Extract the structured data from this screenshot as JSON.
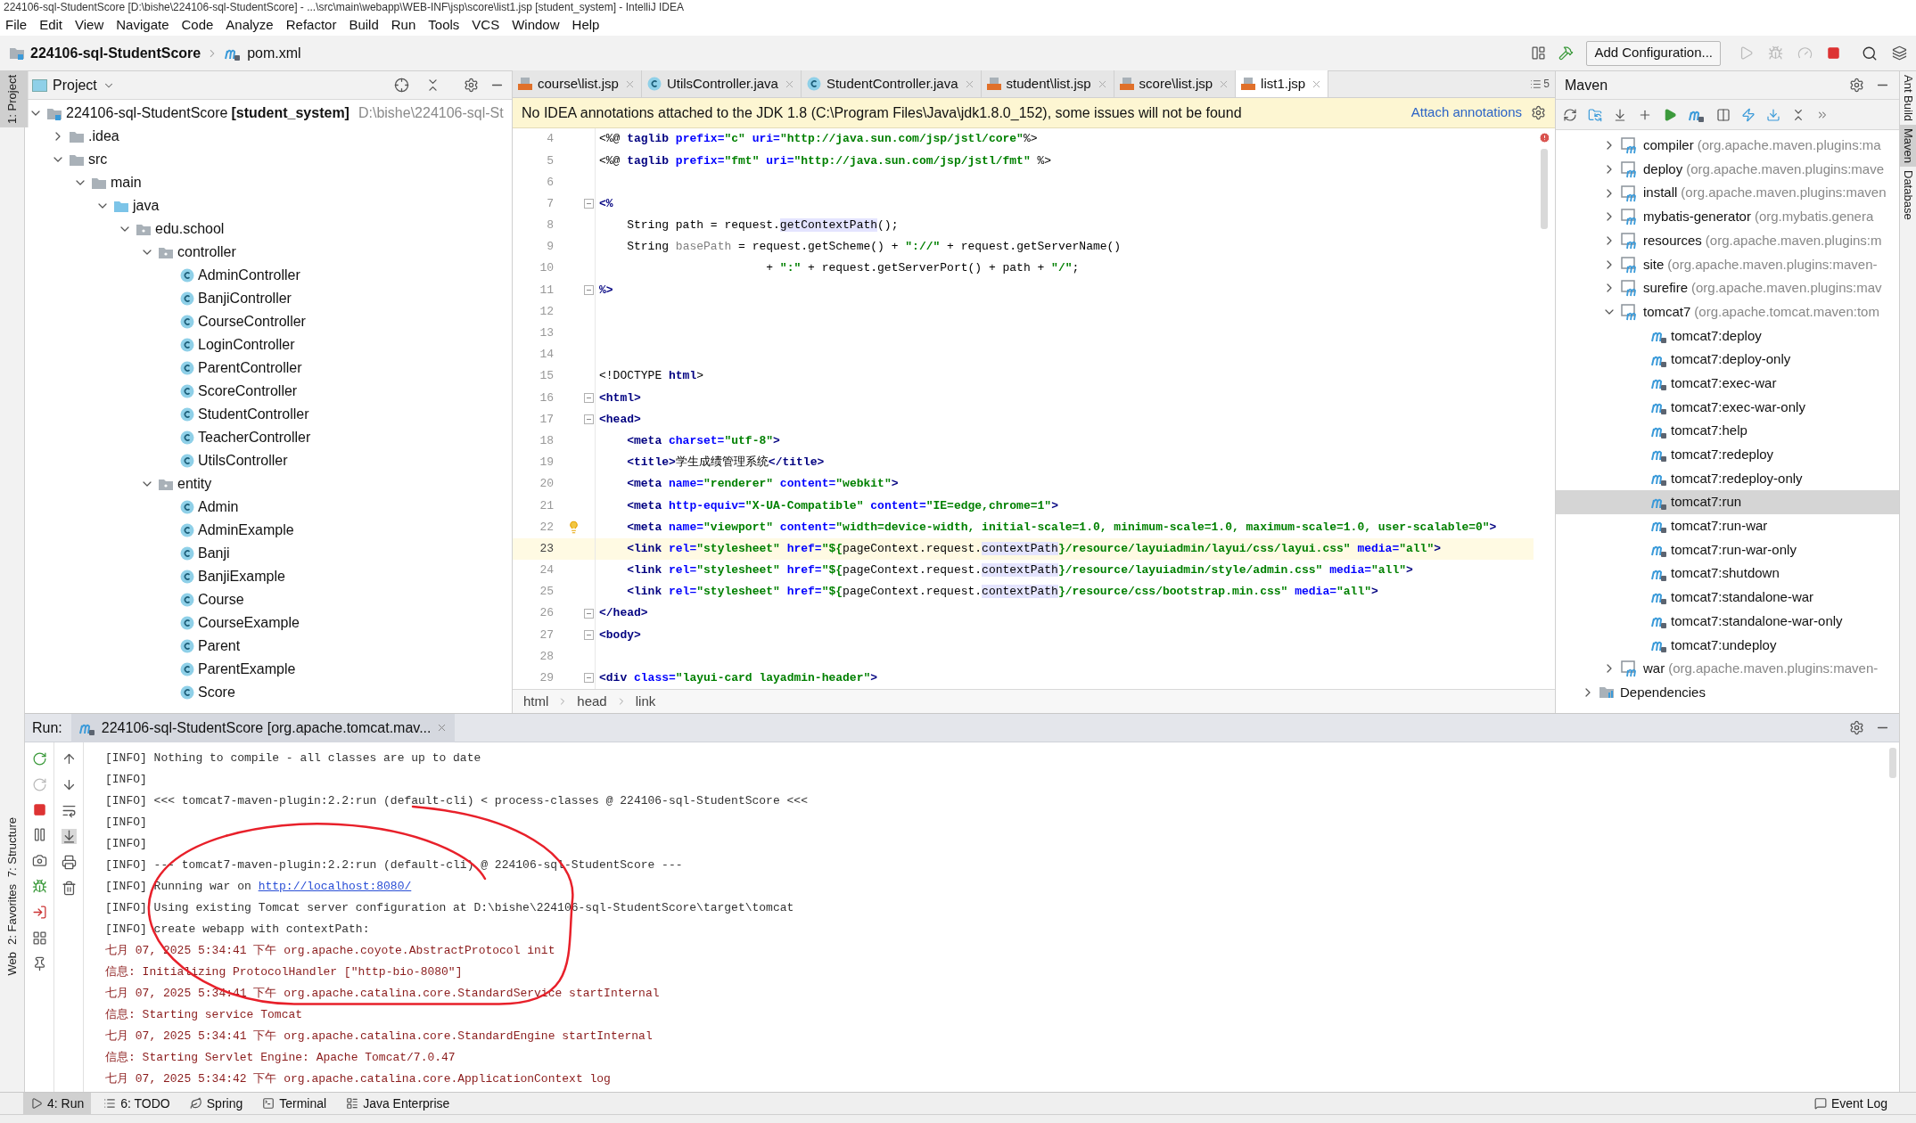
{
  "window": {
    "title": "224106-sql-StudentScore [D:\\bishe\\224106-sql-StudentScore] - ...\\src\\main\\webapp\\WEB-INF\\jsp\\score\\list1.jsp [student_system] - IntelliJ IDEA"
  },
  "menu": [
    "File",
    "Edit",
    "View",
    "Navigate",
    "Code",
    "Analyze",
    "Refactor",
    "Build",
    "Run",
    "Tools",
    "VCS",
    "Window",
    "Help"
  ],
  "navbar": {
    "project": "224106-sql-StudentScore",
    "file": "pom.xml",
    "run_config": "Add Configuration..."
  },
  "side_tabs_left": [
    {
      "label": "1: Project",
      "selected": true,
      "kind": "top"
    },
    {
      "label": "7: Structure",
      "selected": false,
      "kind": "bottom"
    },
    {
      "label": "2: Favorites",
      "selected": false,
      "kind": "bottom"
    },
    {
      "label": "Web",
      "selected": false,
      "kind": "bottom"
    }
  ],
  "side_tabs_right": [
    {
      "label": "Ant Build",
      "selected": false
    },
    {
      "label": "Maven",
      "selected": true
    },
    {
      "label": "Database",
      "selected": false
    }
  ],
  "project": {
    "title": "Project",
    "tree": [
      {
        "label": "224106-sql-StudentScore",
        "module": "[student_system]",
        "path": "D:\\bishe\\224106-sql-St",
        "kind": "module",
        "expanded": true,
        "children": [
          {
            "label": ".idea",
            "kind": "folder",
            "expanded": false
          },
          {
            "label": "src",
            "kind": "folder",
            "expanded": true,
            "children": [
              {
                "label": "main",
                "kind": "folder",
                "expanded": true,
                "children": [
                  {
                    "label": "java",
                    "kind": "source",
                    "expanded": true,
                    "children": [
                      {
                        "label": "edu.school",
                        "kind": "package",
                        "expanded": true,
                        "children": [
                          {
                            "label": "controller",
                            "kind": "package",
                            "expanded": true,
                            "children": [
                              {
                                "label": "AdminController",
                                "kind": "class"
                              },
                              {
                                "label": "BanjiController",
                                "kind": "class"
                              },
                              {
                                "label": "CourseController",
                                "kind": "class"
                              },
                              {
                                "label": "LoginController",
                                "kind": "class"
                              },
                              {
                                "label": "ParentController",
                                "kind": "class"
                              },
                              {
                                "label": "ScoreController",
                                "kind": "class"
                              },
                              {
                                "label": "StudentController",
                                "kind": "class"
                              },
                              {
                                "label": "TeacherController",
                                "kind": "class"
                              },
                              {
                                "label": "UtilsController",
                                "kind": "class"
                              }
                            ]
                          },
                          {
                            "label": "entity",
                            "kind": "package",
                            "expanded": true,
                            "children": [
                              {
                                "label": "Admin",
                                "kind": "class"
                              },
                              {
                                "label": "AdminExample",
                                "kind": "class"
                              },
                              {
                                "label": "Banji",
                                "kind": "class"
                              },
                              {
                                "label": "BanjiExample",
                                "kind": "class"
                              },
                              {
                                "label": "Course",
                                "kind": "class"
                              },
                              {
                                "label": "CourseExample",
                                "kind": "class"
                              },
                              {
                                "label": "Parent",
                                "kind": "class"
                              },
                              {
                                "label": "ParentExample",
                                "kind": "class"
                              },
                              {
                                "label": "Score",
                                "kind": "class"
                              }
                            ]
                          }
                        ]
                      }
                    ]
                  }
                ]
              }
            ]
          }
        ]
      }
    ]
  },
  "editor": {
    "tabs": [
      {
        "label": "course\\list.jsp",
        "kind": "jsp",
        "selected": false
      },
      {
        "label": "UtilsController.java",
        "kind": "class",
        "selected": false
      },
      {
        "label": "StudentController.java",
        "kind": "class",
        "selected": false
      },
      {
        "label": "student\\list.jsp",
        "kind": "jsp",
        "selected": false
      },
      {
        "label": "score\\list.jsp",
        "kind": "jsp",
        "selected": false
      },
      {
        "label": "list1.jsp",
        "kind": "jsp",
        "selected": true
      }
    ],
    "tab_count": "5",
    "banner": {
      "text": "No IDEA annotations attached to the JDK 1.8 (C:\\Program Files\\Java\\jdk1.8.0_152), some issues will not be found",
      "action": "Attach annotations"
    },
    "lines": [
      {
        "number": "4",
        "fold": false,
        "current": false,
        "bulb": false,
        "segments": [
          {
            "text": "<%@ ",
            "kind": "plain"
          },
          {
            "text": "taglib ",
            "kind": "tag"
          },
          {
            "text": "prefix=",
            "kind": "attr"
          },
          {
            "text": "\"c\" ",
            "kind": "string"
          },
          {
            "text": "uri=",
            "kind": "attr"
          },
          {
            "text": "\"http://java.sun.com/jsp/jstl/core\"",
            "kind": "string"
          },
          {
            "text": "%>",
            "kind": "plain"
          }
        ]
      },
      {
        "number": "5",
        "fold": false,
        "current": false,
        "bulb": false,
        "segments": [
          {
            "text": "<%@ ",
            "kind": "plain"
          },
          {
            "text": "taglib ",
            "kind": "tag"
          },
          {
            "text": "prefix=",
            "kind": "attr"
          },
          {
            "text": "\"fmt\" ",
            "kind": "string"
          },
          {
            "text": "uri=",
            "kind": "attr"
          },
          {
            "text": "\"http://java.sun.com/jsp/jstl/fmt\" ",
            "kind": "string"
          },
          {
            "text": "%>",
            "kind": "plain"
          }
        ]
      },
      {
        "number": "6",
        "fold": false,
        "current": false,
        "bulb": false
      },
      {
        "number": "7",
        "fold": true,
        "current": false,
        "bulb": false,
        "segments": [
          {
            "text": "<%",
            "kind": "tag"
          }
        ]
      },
      {
        "number": "8",
        "fold": false,
        "current": false,
        "bulb": false,
        "segments": [
          {
            "text": "    String path = request.",
            "kind": "plain"
          },
          {
            "text": "getContextPath",
            "kind": "highlight"
          },
          {
            "text": "();",
            "kind": "plain"
          }
        ]
      },
      {
        "number": "9",
        "fold": false,
        "current": false,
        "bulb": false,
        "segments": [
          {
            "text": "    String ",
            "kind": "plain"
          },
          {
            "text": "basePath",
            "kind": "unused"
          },
          {
            "text": " = request.getScheme() + ",
            "kind": "plain"
          },
          {
            "text": "\"://\"",
            "kind": "string"
          },
          {
            "text": " + request.getServerName()",
            "kind": "plain"
          }
        ]
      },
      {
        "number": "10",
        "fold": false,
        "current": false,
        "bulb": false,
        "segments": [
          {
            "text": "                        + ",
            "kind": "plain"
          },
          {
            "text": "\":\"",
            "kind": "string"
          },
          {
            "text": " + request.getServerPort() + path + ",
            "kind": "plain"
          },
          {
            "text": "\"/\"",
            "kind": "string"
          },
          {
            "text": ";",
            "kind": "plain"
          }
        ]
      },
      {
        "number": "11",
        "fold": true,
        "current": false,
        "bulb": false,
        "segments": [
          {
            "text": "%>",
            "kind": "tag"
          }
        ]
      },
      {
        "number": "12",
        "fold": false,
        "current": false,
        "bulb": false
      },
      {
        "number": "13",
        "fold": false,
        "current": false,
        "bulb": false
      },
      {
        "number": "14",
        "fold": false,
        "current": false,
        "bulb": false
      },
      {
        "number": "15",
        "fold": false,
        "current": false,
        "bulb": false,
        "segments": [
          {
            "text": "<!DOCTYPE ",
            "kind": "plain"
          },
          {
            "text": "html",
            "kind": "tag"
          },
          {
            "text": ">",
            "kind": "plain"
          }
        ]
      },
      {
        "number": "16",
        "fold": true,
        "current": false,
        "bulb": false,
        "segments": [
          {
            "text": "<html>",
            "kind": "tag"
          }
        ]
      },
      {
        "number": "17",
        "fold": true,
        "current": false,
        "bulb": false,
        "segments": [
          {
            "text": "<head>",
            "kind": "tag"
          }
        ]
      },
      {
        "number": "18",
        "fold": false,
        "current": false,
        "bulb": false,
        "segments": [
          {
            "text": "    <meta ",
            "kind": "tag"
          },
          {
            "text": "charset=",
            "kind": "attr"
          },
          {
            "text": "\"utf-8\"",
            "kind": "string"
          },
          {
            "text": ">",
            "kind": "tag"
          }
        ]
      },
      {
        "number": "19",
        "fold": false,
        "current": false,
        "bulb": false,
        "segments": [
          {
            "text": "    <title>",
            "kind": "tag"
          },
          {
            "text": "学生成绩管理系统",
            "kind": "plain"
          },
          {
            "text": "</title>",
            "kind": "tag"
          }
        ]
      },
      {
        "number": "20",
        "fold": false,
        "current": false,
        "bulb": false,
        "segments": [
          {
            "text": "    <meta ",
            "kind": "tag"
          },
          {
            "text": "name=",
            "kind": "attr"
          },
          {
            "text": "\"renderer\" ",
            "kind": "string"
          },
          {
            "text": "content=",
            "kind": "attr"
          },
          {
            "text": "\"webkit\"",
            "kind": "string"
          },
          {
            "text": ">",
            "kind": "tag"
          }
        ]
      },
      {
        "number": "21",
        "fold": false,
        "current": false,
        "bulb": false,
        "segments": [
          {
            "text": "    <meta ",
            "kind": "tag"
          },
          {
            "text": "http-equiv=",
            "kind": "attr"
          },
          {
            "text": "\"X-UA-Compatible\" ",
            "kind": "string"
          },
          {
            "text": "content=",
            "kind": "attr"
          },
          {
            "text": "\"IE=edge,chrome=1\"",
            "kind": "string"
          },
          {
            "text": ">",
            "kind": "tag"
          }
        ]
      },
      {
        "number": "22",
        "fold": false,
        "current": false,
        "bulb": true,
        "segments": [
          {
            "text": "    <meta ",
            "kind": "tag"
          },
          {
            "text": "name=",
            "kind": "attr"
          },
          {
            "text": "\"viewport\" ",
            "kind": "string"
          },
          {
            "text": "content=",
            "kind": "attr"
          },
          {
            "text": "\"width=device-width, initial-scale=1.0, minimum-scale=1.0, maximum-scale=1.0, user-scalable=0\"",
            "kind": "string"
          },
          {
            "text": ">",
            "kind": "tag"
          }
        ]
      },
      {
        "number": "23",
        "fold": false,
        "current": true,
        "bulb": false,
        "segments": [
          {
            "text": "    <link ",
            "kind": "tag"
          },
          {
            "text": "rel=",
            "kind": "attr"
          },
          {
            "text": "\"stylesheet\" ",
            "kind": "string"
          },
          {
            "text": "href=",
            "kind": "attr"
          },
          {
            "text": "\"${",
            "kind": "string"
          },
          {
            "text": "pageContext.request.",
            "kind": "plain"
          },
          {
            "text": "contextPath",
            "kind": "highlight"
          },
          {
            "text": "}/resource/layuiadmin/layui/css/layui.css\" ",
            "kind": "string"
          },
          {
            "text": "media=",
            "kind": "attr"
          },
          {
            "text": "\"all\"",
            "kind": "string"
          },
          {
            "text": ">",
            "kind": "tag"
          }
        ]
      },
      {
        "number": "24",
        "fold": false,
        "current": false,
        "bulb": false,
        "segments": [
          {
            "text": "    <link ",
            "kind": "tag"
          },
          {
            "text": "rel=",
            "kind": "attr"
          },
          {
            "text": "\"stylesheet\" ",
            "kind": "string"
          },
          {
            "text": "href=",
            "kind": "attr"
          },
          {
            "text": "\"${",
            "kind": "string"
          },
          {
            "text": "pageContext.request.",
            "kind": "plain"
          },
          {
            "text": "contextPath",
            "kind": "highlight"
          },
          {
            "text": "}/resource/layuiadmin/style/admin.css\" ",
            "kind": "string"
          },
          {
            "text": "media=",
            "kind": "attr"
          },
          {
            "text": "\"all\"",
            "kind": "string"
          },
          {
            "text": ">",
            "kind": "tag"
          }
        ]
      },
      {
        "number": "25",
        "fold": false,
        "current": false,
        "bulb": false,
        "segments": [
          {
            "text": "    <link ",
            "kind": "tag"
          },
          {
            "text": "rel=",
            "kind": "attr"
          },
          {
            "text": "\"stylesheet\" ",
            "kind": "string"
          },
          {
            "text": "href=",
            "kind": "attr"
          },
          {
            "text": "\"${",
            "kind": "string"
          },
          {
            "text": "pageContext.request.",
            "kind": "plain"
          },
          {
            "text": "contextPath",
            "kind": "highlight"
          },
          {
            "text": "}/resource/css/bootstrap.min.css\" ",
            "kind": "string"
          },
          {
            "text": "media=",
            "kind": "attr"
          },
          {
            "text": "\"all\"",
            "kind": "string"
          },
          {
            "text": ">",
            "kind": "tag"
          }
        ]
      },
      {
        "number": "26",
        "fold": true,
        "current": false,
        "bulb": false,
        "segments": [
          {
            "text": "</head>",
            "kind": "tag"
          }
        ]
      },
      {
        "number": "27",
        "fold": true,
        "current": false,
        "bulb": false,
        "segments": [
          {
            "text": "<body>",
            "kind": "tag"
          }
        ]
      },
      {
        "number": "28",
        "fold": false,
        "current": false,
        "bulb": false
      },
      {
        "number": "29",
        "fold": true,
        "current": false,
        "bulb": false,
        "segments": [
          {
            "text": "<div ",
            "kind": "tag"
          },
          {
            "text": "class=",
            "kind": "attr"
          },
          {
            "text": "\"layui-card layadmin-header\"",
            "kind": "string"
          },
          {
            "text": ">",
            "kind": "tag"
          }
        ]
      }
    ],
    "breadcrumbs": [
      "html",
      "head",
      "link"
    ]
  },
  "maven": {
    "title": "Maven",
    "plugins": [
      {
        "name": "compiler",
        "detail": "(org.apache.maven.plugins:ma",
        "expanded": false
      },
      {
        "name": "deploy",
        "detail": "(org.apache.maven.plugins:mave",
        "expanded": false
      },
      {
        "name": "install",
        "detail": "(org.apache.maven.plugins:maven",
        "expanded": false
      },
      {
        "name": "mybatis-generator",
        "detail": "(org.mybatis.genera",
        "expanded": false
      },
      {
        "name": "resources",
        "detail": "(org.apache.maven.plugins:m",
        "expanded": false
      },
      {
        "name": "site",
        "detail": "(org.apache.maven.plugins:maven-",
        "expanded": false
      },
      {
        "name": "surefire",
        "detail": "(org.apache.maven.plugins:mav",
        "expanded": false
      },
      {
        "name": "tomcat7",
        "detail": "(org.apache.tomcat.maven:tom",
        "expanded": true,
        "goals": [
          {
            "label": "tomcat7:deploy",
            "selected": false
          },
          {
            "label": "tomcat7:deploy-only",
            "selected": false
          },
          {
            "label": "tomcat7:exec-war",
            "selected": false
          },
          {
            "label": "tomcat7:exec-war-only",
            "selected": false
          },
          {
            "label": "tomcat7:help",
            "selected": false
          },
          {
            "label": "tomcat7:redeploy",
            "selected": false
          },
          {
            "label": "tomcat7:redeploy-only",
            "selected": false
          },
          {
            "label": "tomcat7:run",
            "selected": true
          },
          {
            "label": "tomcat7:run-war",
            "selected": false
          },
          {
            "label": "tomcat7:run-war-only",
            "selected": false
          },
          {
            "label": "tomcat7:shutdown",
            "selected": false
          },
          {
            "label": "tomcat7:standalone-war",
            "selected": false
          },
          {
            "label": "tomcat7:standalone-war-only",
            "selected": false
          },
          {
            "label": "tomcat7:undeploy",
            "selected": false
          }
        ]
      },
      {
        "name": "war",
        "detail": "(org.apache.maven.plugins:maven-",
        "expanded": false
      }
    ],
    "dependencies": {
      "label": "Dependencies",
      "expanded": false
    }
  },
  "run": {
    "label": "Run:",
    "tab": "224106-sql-StudentScore [org.apache.tomcat.mav...",
    "lines": [
      {
        "kind": "info",
        "text": "[INFO] Nothing to compile - all classes are up to date"
      },
      {
        "kind": "info",
        "text": "[INFO]"
      },
      {
        "kind": "info",
        "text": "[INFO] <<< tomcat7-maven-plugin:2.2:run (default-cli) < process-classes @ 224106-sql-StudentScore <<<"
      },
      {
        "kind": "info",
        "text": "[INFO]"
      },
      {
        "kind": "info",
        "text": "[INFO]"
      },
      {
        "kind": "info",
        "text": "[INFO] --- tomcat7-maven-plugin:2.2:run (default-cli) @ 224106-sql-StudentScore ---"
      },
      {
        "kind": "info",
        "text": "[INFO] Running war on ",
        "link": "http://localhost:8080/"
      },
      {
        "kind": "info",
        "text": "[INFO] Using existing Tomcat server configuration at D:\\bishe\\224106-sql-StudentScore\\target\\tomcat"
      },
      {
        "kind": "info",
        "text": "[INFO] create webapp with contextPath:"
      },
      {
        "kind": "log",
        "text": "七月 07, 2025 5:34:41 下午 org.apache.coyote.AbstractProtocol init"
      },
      {
        "kind": "log",
        "text": "信息: Initializing ProtocolHandler [\"http-bio-8080\"]"
      },
      {
        "kind": "log",
        "text": "七月 07, 2025 5:34:41 下午 org.apache.catalina.core.StandardService startInternal"
      },
      {
        "kind": "log",
        "text": "信息: Starting service Tomcat"
      },
      {
        "kind": "log",
        "text": "七月 07, 2025 5:34:41 下午 org.apache.catalina.core.StandardEngine startInternal"
      },
      {
        "kind": "log",
        "text": "信息: Starting Servlet Engine: Apache Tomcat/7.0.47"
      },
      {
        "kind": "log",
        "text": "七月 07, 2025 5:34:42 下午 org.apache.catalina.core.ApplicationContext log"
      }
    ]
  },
  "bottom_tabs": [
    {
      "label": "4: Run",
      "kind": "run",
      "selected": true
    },
    {
      "label": "6: TODO",
      "kind": "todo",
      "selected": false
    },
    {
      "label": "Spring",
      "kind": "spring",
      "selected": false
    },
    {
      "label": "Terminal",
      "kind": "terminal",
      "selected": false
    },
    {
      "label": "Java Enterprise",
      "kind": "enterprise",
      "selected": false
    }
  ],
  "event_log": "Event Log"
}
